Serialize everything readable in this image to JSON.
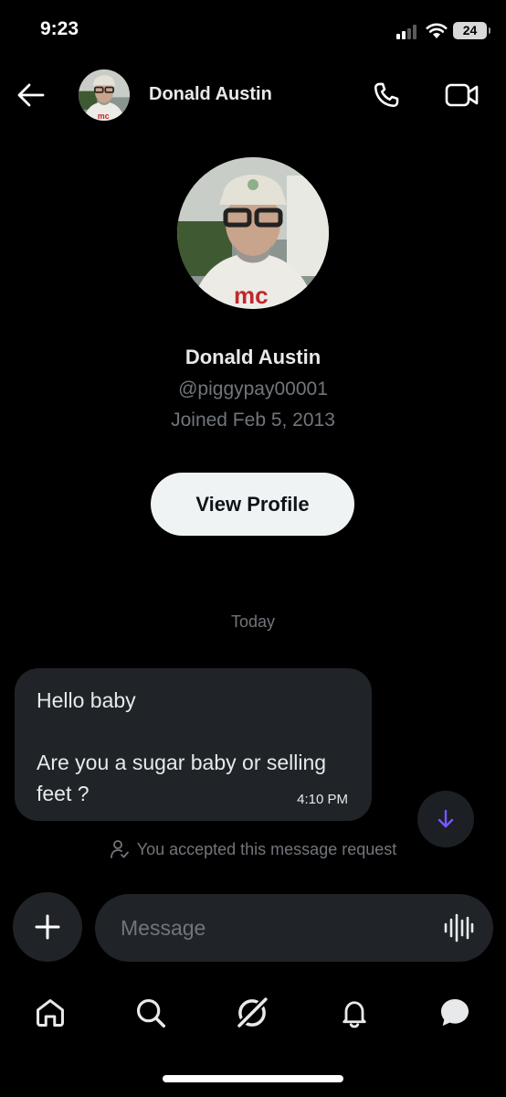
{
  "status_bar": {
    "time": "9:23",
    "battery": "24"
  },
  "header": {
    "name": "Donald Austin",
    "icons": {
      "back": "arrow-left-icon",
      "call": "phone-icon",
      "video": "video-camera-icon"
    }
  },
  "profile": {
    "name": "Donald Austin",
    "handle": "@piggypay00001",
    "joined": "Joined Feb 5, 2013",
    "view_profile_label": "View Profile"
  },
  "conversation": {
    "date_divider": "Today",
    "message": {
      "line1": "Hello baby",
      "line2": "Are you a sugar baby or selling",
      "line3": "feet ?",
      "time": "4:10 PM"
    },
    "accepted_notice": "You accepted this message request"
  },
  "composer": {
    "placeholder": "Message"
  },
  "bottom_nav": {
    "items": [
      "home-icon",
      "search-icon",
      "grok-icon",
      "bell-icon",
      "messages-icon"
    ]
  },
  "colors": {
    "background": "#000000",
    "bubble": "#202327",
    "secondary_text": "#71767b",
    "accent": "#7856ff"
  }
}
